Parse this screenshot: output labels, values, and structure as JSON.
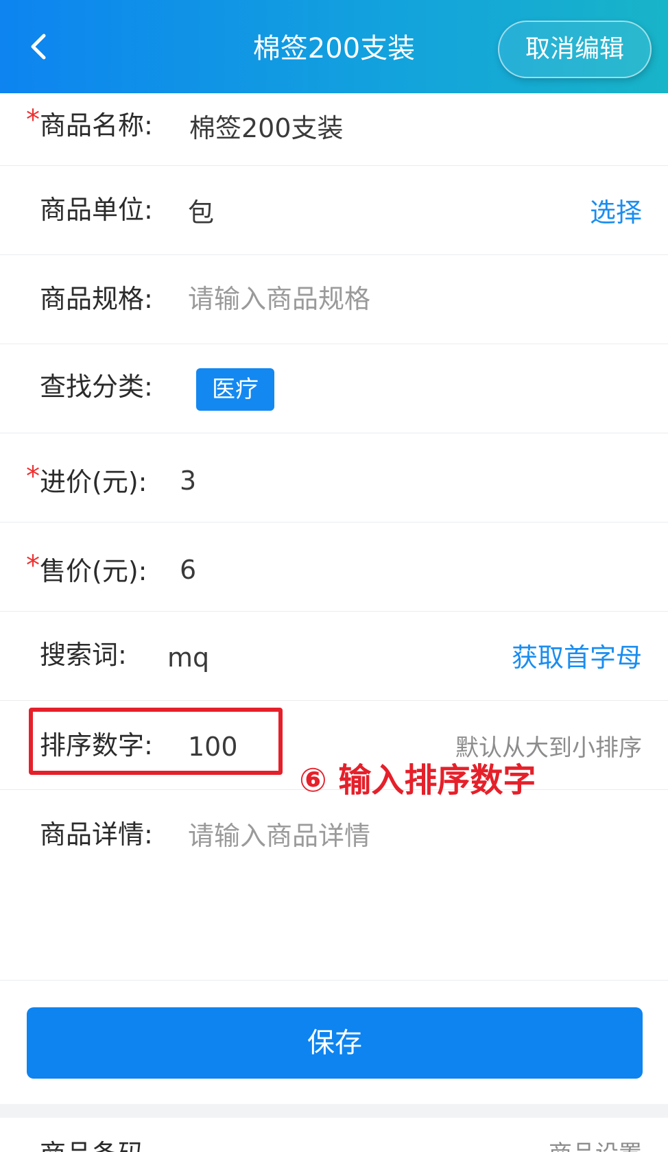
{
  "header": {
    "title": "棉签200支装",
    "cancel_label": "取消编辑"
  },
  "form": {
    "name": {
      "label": "商品名称:",
      "value": "棉签200支装",
      "required": true
    },
    "unit": {
      "label": "商品单位:",
      "value": "包",
      "action": "选择"
    },
    "spec": {
      "label": "商品规格:",
      "placeholder": "请输入商品规格"
    },
    "category": {
      "label": "查找分类:",
      "chip": "医疗"
    },
    "cost": {
      "label": "进价(元):",
      "value": "3",
      "required": true
    },
    "price": {
      "label": "售价(元):",
      "value": "6",
      "required": true
    },
    "keyword": {
      "label": "搜索词:",
      "value": "mq",
      "action": "获取首字母"
    },
    "sort": {
      "label": "排序数字:",
      "value": "100",
      "hint": "默认从大到小排序"
    },
    "detail": {
      "label": "商品详情:",
      "placeholder": "请输入商品详情"
    }
  },
  "annotation": {
    "text": "⑥ 输入排序数字"
  },
  "save_label": "保存",
  "next_section": {
    "label": "商品条码",
    "hint": "商品设置"
  },
  "colors": {
    "accent": "#0d84f0",
    "required": "#ee3030",
    "annotation": "#e5202a"
  }
}
